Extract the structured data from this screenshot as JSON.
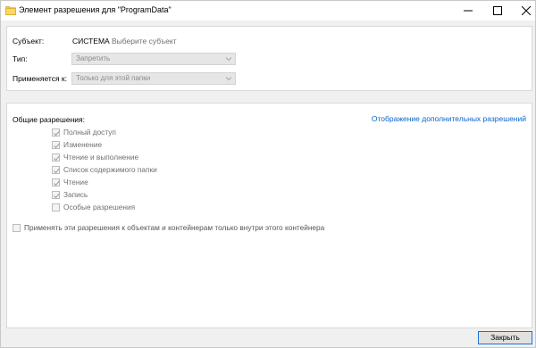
{
  "window": {
    "title": "Элемент разрешения для \"ProgramData\"",
    "title_icon": "folder-icon",
    "controls": [
      "minimize-icon",
      "maximize-icon",
      "close-icon"
    ]
  },
  "principal": {
    "label": "Субъект:",
    "value": "СИСТЕМА",
    "select_link": "Выберите субъект"
  },
  "type": {
    "label": "Тип:",
    "value": "Запретить"
  },
  "applies_to": {
    "label": "Применяется к:",
    "value": "Только для этой папки"
  },
  "permissions": {
    "heading": "Общие разрешения:",
    "advanced_link": "Отображение дополнительных разрешений",
    "items": [
      {
        "label": "Полный доступ",
        "checked": true
      },
      {
        "label": "Изменение",
        "checked": true
      },
      {
        "label": "Чтение и выполнение",
        "checked": true
      },
      {
        "label": "Список содержимого папки",
        "checked": true
      },
      {
        "label": "Чтение",
        "checked": true
      },
      {
        "label": "Запись",
        "checked": true
      },
      {
        "label": "Особые разрешения",
        "checked": false
      }
    ],
    "apply_inside_label": "Применять эти разрешения к объектам и контейнерам только внутри этого контейнера",
    "apply_inside_checked": false
  },
  "footer": {
    "close_label": "Закрыть"
  },
  "colors": {
    "link": "#0a64c8",
    "button_border": "#1a73d9",
    "disabled_text": "#707070"
  }
}
